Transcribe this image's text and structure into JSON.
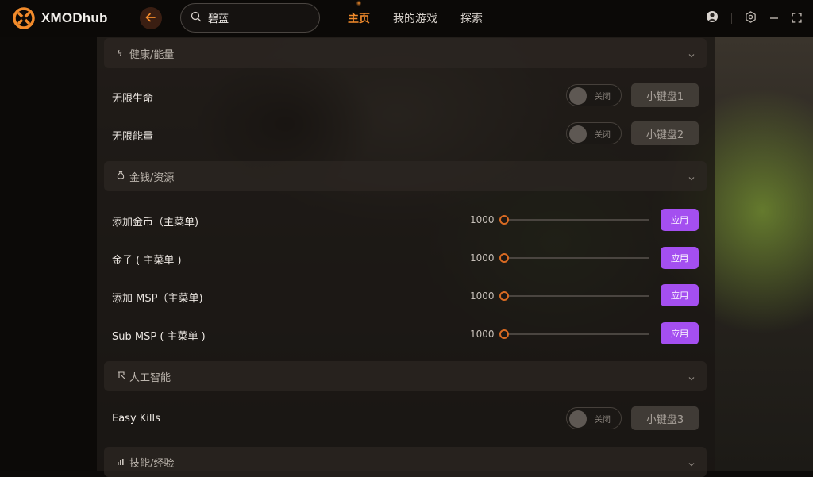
{
  "app": {
    "logo_text": "XMODhub"
  },
  "search": {
    "value": "碧蓝"
  },
  "nav": {
    "home": "主页",
    "my_games": "我的游戏",
    "explore": "探索"
  },
  "colors": {
    "accent": "#f28b2b",
    "apply": "#a44ff0",
    "slider_thumb": "#d86a22"
  },
  "sections": {
    "health": {
      "icon": "lightning-icon",
      "label": "健康/能量"
    },
    "money": {
      "icon": "money-bag-icon",
      "label": "金钱/资源"
    },
    "ai": {
      "icon": "ai-icon",
      "label": "人工智能"
    },
    "skills": {
      "icon": "bar-chart-icon",
      "label": "技能/经验"
    }
  },
  "toggle_rows": [
    {
      "label": "无限生命",
      "toggle_state": "关闭",
      "hotkey": "小键盘1"
    },
    {
      "label": "无限能量",
      "toggle_state": "关闭",
      "hotkey": "小键盘2"
    },
    {
      "label": "Easy Kills",
      "toggle_state": "关闭",
      "hotkey": "小键盘3"
    }
  ],
  "slider_rows": [
    {
      "label": "添加金币（主菜单)",
      "value": "1000",
      "apply": "应用",
      "level": 0
    },
    {
      "label": "金子 ( 主菜单 )",
      "value": "1000",
      "apply": "应用",
      "level": 0
    },
    {
      "label": "添加 MSP（主菜单)",
      "value": "1000",
      "apply": "应用",
      "level": 0
    },
    {
      "label": "Sub MSP ( 主菜单 )",
      "value": "1000",
      "apply": "应用",
      "level": 0
    }
  ]
}
